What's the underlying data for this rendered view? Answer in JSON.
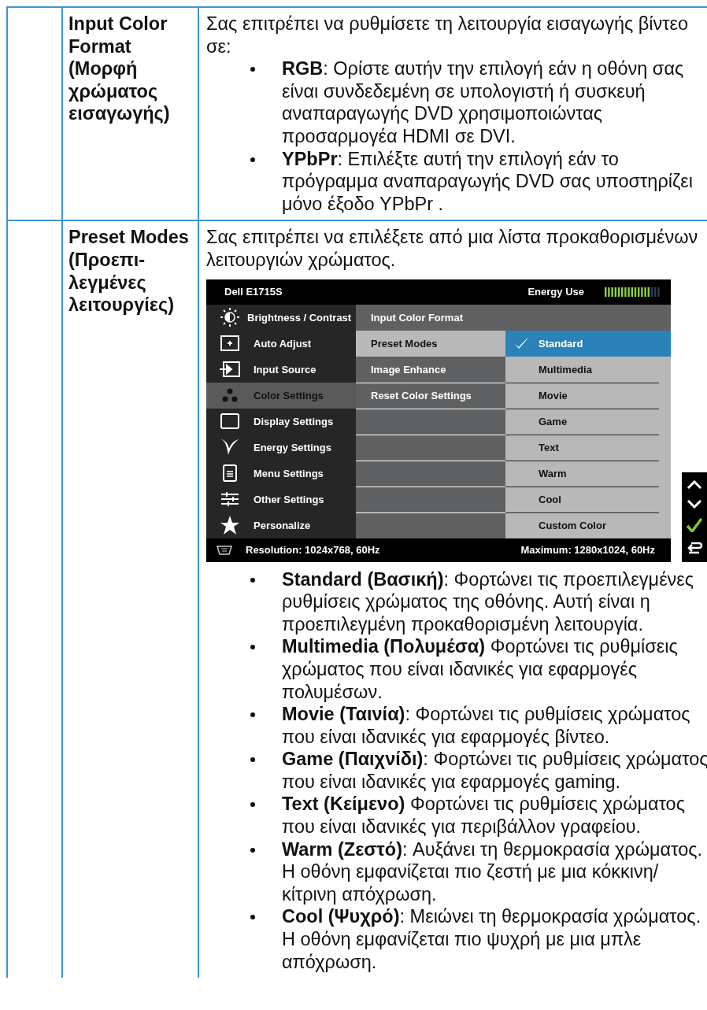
{
  "table": {
    "rows": [
      {
        "setting": "Input Color Format (Μορφή χρώματος εισαγωγής)",
        "description": "Σας επιτρέπει να ρυθμίσετε τη λειτουργία εισαγωγής βίντεο σε:",
        "bullets": [
          "**RGB**: Ορίστε αυτήν την επιλογή εάν η οθόνη σας είναι συνδεδεμένη σε υπολογιστή ή συσκευή αναπαραγωγής DVD χρησιμοποιώντας προσαρμογέα HDMI σε DVI.",
          "**YPbPr**: Επιλέξτε αυτή την επιλογή εάν το πρόγραμμα αναπαραγωγής DVD σας υποστηρίζει μόνο έξοδο YPbPr ."
        ]
      },
      {
        "setting": "Preset Modes (Προεπι-λεγμένες λειτουργίες)",
        "description": "Σας επιτρέπει να επιλέξετε από μια λίστα προκαθορισμένων λειτουργιών χρώματος.",
        "osd": {
          "model": "Dell E1715S",
          "energy_label": "Energy Use",
          "energy_meter": {
            "level": 0.82
          },
          "main_menu": [
            {
              "label": "Brightness / Contrast",
              "selected": false
            },
            {
              "label": "Auto Adjust",
              "selected": false
            },
            {
              "label": "Input Source",
              "selected": false
            },
            {
              "label": "Color Settings",
              "selected": true
            },
            {
              "label": "Display Settings",
              "selected": false
            },
            {
              "label": "Energy Settings",
              "selected": false
            },
            {
              "label": "Menu Settings",
              "selected": false
            },
            {
              "label": "Other Settings",
              "selected": false
            },
            {
              "label": "Personalize",
              "selected": false
            }
          ],
          "submenu": [
            {
              "label": "Input Color Format",
              "selected": false
            },
            {
              "label": "Preset Modes",
              "selected": true
            },
            {
              "label": "Image Enhance",
              "selected": false
            },
            {
              "label": "Reset Color Settings",
              "selected": false
            }
          ],
          "options": [
            {
              "label": "Standard",
              "selected": true
            },
            {
              "label": "Multimedia",
              "selected": false
            },
            {
              "label": "Movie",
              "selected": false
            },
            {
              "label": "Game",
              "selected": false
            },
            {
              "label": "Text",
              "selected": false
            },
            {
              "label": "Warm",
              "selected": false
            },
            {
              "label": "Cool",
              "selected": false
            },
            {
              "label": "Custom Color",
              "selected": false
            }
          ],
          "footer": {
            "resolution": "Resolution: 1024x768, 60Hz",
            "maximum": "Maximum: 1280x1024, 60Hz"
          }
        },
        "bullets": [
          "**Standard (Βασική)**: Φορτώνει τις προεπιλεγμένες ρυθμίσεις χρώματος της οθόνης. Αυτή είναι η προεπιλεγμένη προκαθορισμένη λειτουργία.",
          "**Multimedia (Πολυμέσα)** Φορτώνει τις ρυθμίσεις χρώματος που είναι ιδανικές για εφαρμογές πολυμέσων.",
          "**Movie (Ταινία)**: Φορτώνει τις ρυθμίσεις χρώματος που είναι ιδανικές για εφαρμογές βίντεο.",
          "**Game (Παιχνίδι)**: Φορτώνει τις ρυθμίσεις χρώματος που είναι ιδανικές για εφαρμογές gaming.",
          "**Text (Κείμενο)** Φορτώνει τις ρυθμίσεις χρώματος που είναι ιδανικές για περιβάλλον γραφείου.",
          "**Warm (Ζεστό)**: Αυξάνει τη θερμοκρασία χρώματος. Η οθόνη εμφανίζεται πιο ζεστή με μια κόκκινη/κίτρινη απόχρωση.",
          "**Cool (Ψυχρό)**: Μειώνει τη θερμοκρασία χρώματος. Η οθόνη εμφανίζεται πιο ψυχρή με μια μπλε απόχρωση."
        ]
      }
    ]
  }
}
